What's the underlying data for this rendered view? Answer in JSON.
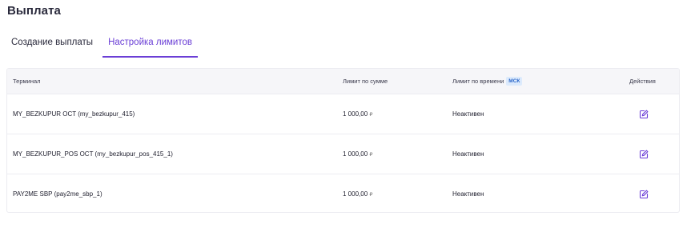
{
  "page": {
    "title": "Выплата"
  },
  "tabs": [
    {
      "label": "Создание выплаты",
      "active": false
    },
    {
      "label": "Настройка лимитов",
      "active": true
    }
  ],
  "table": {
    "headers": {
      "terminal": "Терминал",
      "sum_limit": "Лимит по сумме",
      "time_limit": "Лимит по времени",
      "time_badge": "МСК",
      "actions": "Действия"
    },
    "rows": [
      {
        "terminal": "MY_BEZKUPUR OCT (my_bezkupur_415)",
        "sum": "1 000,00",
        "currency": "₽",
        "status": "Неактивен"
      },
      {
        "terminal": "MY_BEZKUPUR_POS OCT (my_bezkupur_pos_415_1)",
        "sum": "1 000,00",
        "currency": "₽",
        "status": "Неактивен"
      },
      {
        "terminal": "PAY2ME SBP (pay2me_sbp_1)",
        "sum": "1 000,00",
        "currency": "₽",
        "status": "Неактивен"
      }
    ]
  },
  "colors": {
    "accent": "#6b3fd6",
    "badge_bg": "#dceafc",
    "badge_text": "#2b66c9"
  },
  "icons": {
    "row_action": "edit-icon"
  }
}
